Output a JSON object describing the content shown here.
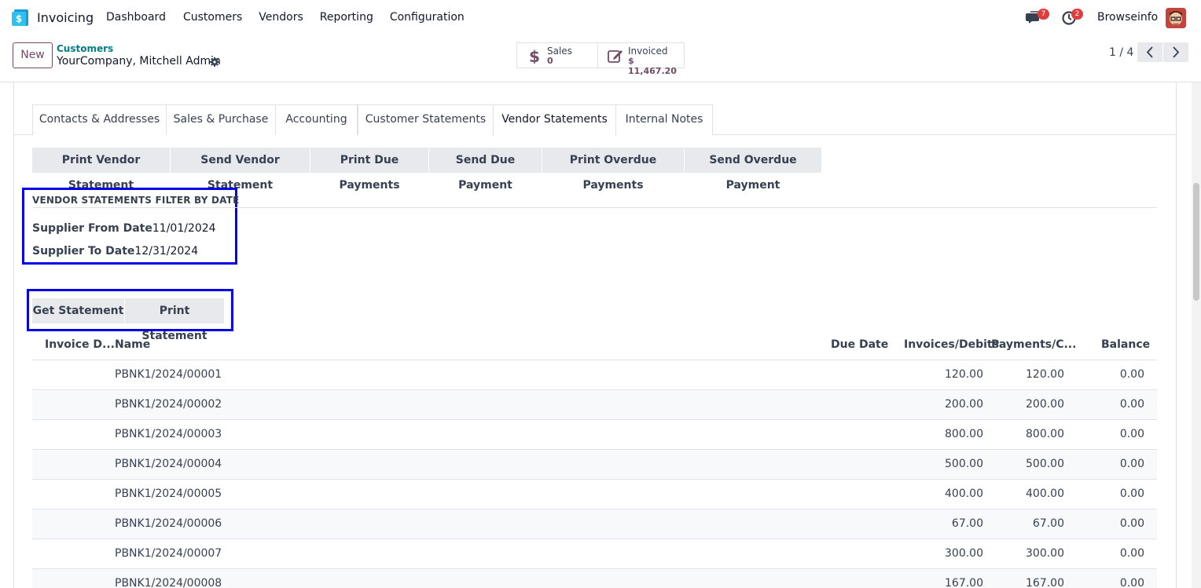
{
  "navbar": {
    "app_name": "Invoicing",
    "menu": [
      "Dashboard",
      "Customers",
      "Vendors",
      "Reporting",
      "Configuration"
    ],
    "messages_count": "7",
    "activities_count": "2",
    "company": "Browseinfo"
  },
  "control_panel": {
    "new_label": "New",
    "breadcrumb_parent": "Customers",
    "breadcrumb_current": "YourCompany, Mitchell Admin",
    "smart_sales_label": "Sales",
    "smart_sales_value": "0",
    "smart_invoiced_label": "Invoiced",
    "smart_invoiced_value": "$ 11,467.20",
    "pager": "1 / 4"
  },
  "tabs": [
    "Contacts & Addresses",
    "Sales & Purchase",
    "Accounting",
    "Customer Statements",
    "Vendor Statements",
    "Internal Notes"
  ],
  "active_tab": "Vendor Statements",
  "action_buttons": [
    "Print Vendor Statement",
    "Send Vendor Statement",
    "Print Due Payments",
    "Send Due Payment",
    "Print Overdue Payments",
    "Send Overdue Payment"
  ],
  "filter": {
    "title": "VENDOR STATEMENTS FILTER BY DATE",
    "from_label": "Supplier From Date",
    "from_value": "11/01/2024",
    "to_label": "Supplier To Date",
    "to_value": "12/31/2024"
  },
  "statement_buttons": {
    "get": "Get Statement",
    "print": "Print Statement"
  },
  "table": {
    "columns": [
      "Invoice D...",
      "Name",
      "Due Date",
      "Invoices/Debits",
      "Payments/C...",
      "Balance"
    ],
    "rows": [
      {
        "date": "",
        "name": "PBNK1/2024/00001",
        "due": "",
        "debit": "120.00",
        "payment": "120.00",
        "balance": "0.00"
      },
      {
        "date": "",
        "name": "PBNK1/2024/00002",
        "due": "",
        "debit": "200.00",
        "payment": "200.00",
        "balance": "0.00"
      },
      {
        "date": "",
        "name": "PBNK1/2024/00003",
        "due": "",
        "debit": "800.00",
        "payment": "800.00",
        "balance": "0.00"
      },
      {
        "date": "",
        "name": "PBNK1/2024/00004",
        "due": "",
        "debit": "500.00",
        "payment": "500.00",
        "balance": "0.00"
      },
      {
        "date": "",
        "name": "PBNK1/2024/00005",
        "due": "",
        "debit": "400.00",
        "payment": "400.00",
        "balance": "0.00"
      },
      {
        "date": "",
        "name": "PBNK1/2024/00006",
        "due": "",
        "debit": "67.00",
        "payment": "67.00",
        "balance": "0.00"
      },
      {
        "date": "",
        "name": "PBNK1/2024/00007",
        "due": "",
        "debit": "300.00",
        "payment": "300.00",
        "balance": "0.00"
      },
      {
        "date": "",
        "name": "PBNK1/2024/00008",
        "due": "",
        "debit": "167.00",
        "payment": "167.00",
        "balance": "0.00"
      }
    ]
  },
  "colors": {
    "brand": "#714b67",
    "teal": "#017e84",
    "highlight_box": "#0000e6",
    "badge": "#e03d3d"
  }
}
